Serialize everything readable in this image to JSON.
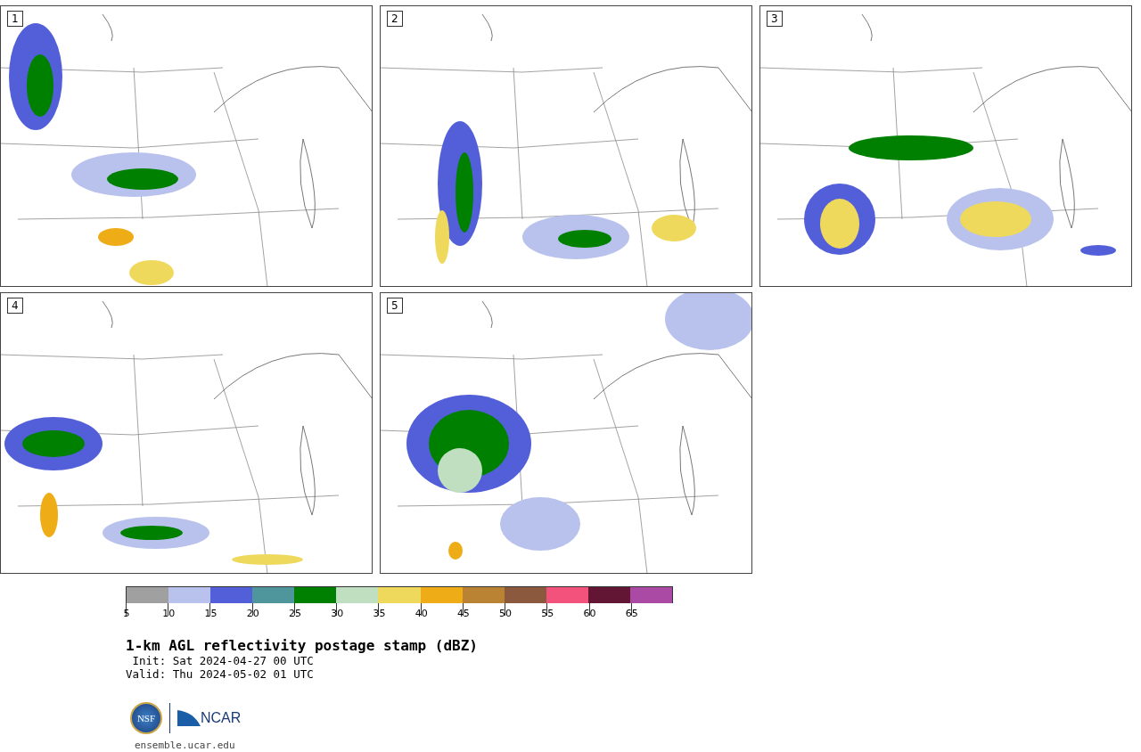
{
  "panels": [
    {
      "label": "1"
    },
    {
      "label": "2"
    },
    {
      "label": "3"
    },
    {
      "label": "4"
    },
    {
      "label": "5"
    }
  ],
  "colorbar": {
    "segments": [
      {
        "color": "#a0a0a0"
      },
      {
        "color": "#b8c2ec"
      },
      {
        "color": "#525fd8"
      },
      {
        "color": "#4e959c"
      },
      {
        "color": "#008000"
      },
      {
        "color": "#bfdfc0"
      },
      {
        "color": "#efd95c"
      },
      {
        "color": "#eeac16"
      },
      {
        "color": "#b98333"
      },
      {
        "color": "#8b5a3e"
      },
      {
        "color": "#f3527d"
      },
      {
        "color": "#631634"
      },
      {
        "color": "#aa4aa5"
      }
    ],
    "ticks": [
      "5",
      "10",
      "15",
      "20",
      "25",
      "30",
      "35",
      "40",
      "45",
      "50",
      "55",
      "60",
      "65"
    ]
  },
  "title": "1-km AGL reflectivity postage stamp (dBZ)",
  "init": " Init: Sat 2024-04-27 00 UTC",
  "valid": "Valid: Thu 2024-05-02 01 UTC",
  "logos": {
    "left": "NSF",
    "right": "NCAR"
  },
  "url": "ensemble.ucar.edu"
}
